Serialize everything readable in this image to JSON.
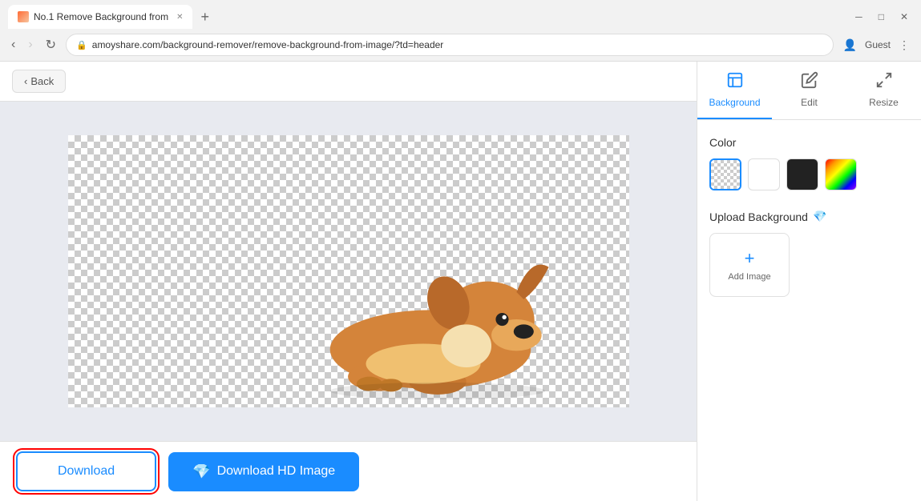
{
  "browser": {
    "tab_title": "No.1 Remove Background from",
    "new_tab_label": "+",
    "address": "amoyshare.com/background-remover/remove-background-from-image/?td=header",
    "nav_back": "‹",
    "nav_forward": "›",
    "nav_refresh": "↻",
    "window_controls": [
      "⋯",
      "─",
      "□",
      "✕"
    ],
    "user_label": "Guest"
  },
  "toolbar": {
    "back_label": "Back"
  },
  "bottom_bar": {
    "download_label": "Download",
    "download_hd_label": "Download HD Image"
  },
  "right_panel": {
    "tabs": [
      {
        "id": "background",
        "label": "Background",
        "active": true
      },
      {
        "id": "edit",
        "label": "Edit",
        "active": false
      },
      {
        "id": "resize",
        "label": "Resize",
        "active": false
      }
    ],
    "color_section_label": "Color",
    "upload_bg_label": "Upload Background",
    "add_image_label": "Add Image",
    "swatches": [
      {
        "id": "transparent",
        "type": "transparent"
      },
      {
        "id": "white",
        "type": "white"
      },
      {
        "id": "black",
        "type": "black"
      },
      {
        "id": "rainbow",
        "type": "rainbow"
      }
    ]
  }
}
